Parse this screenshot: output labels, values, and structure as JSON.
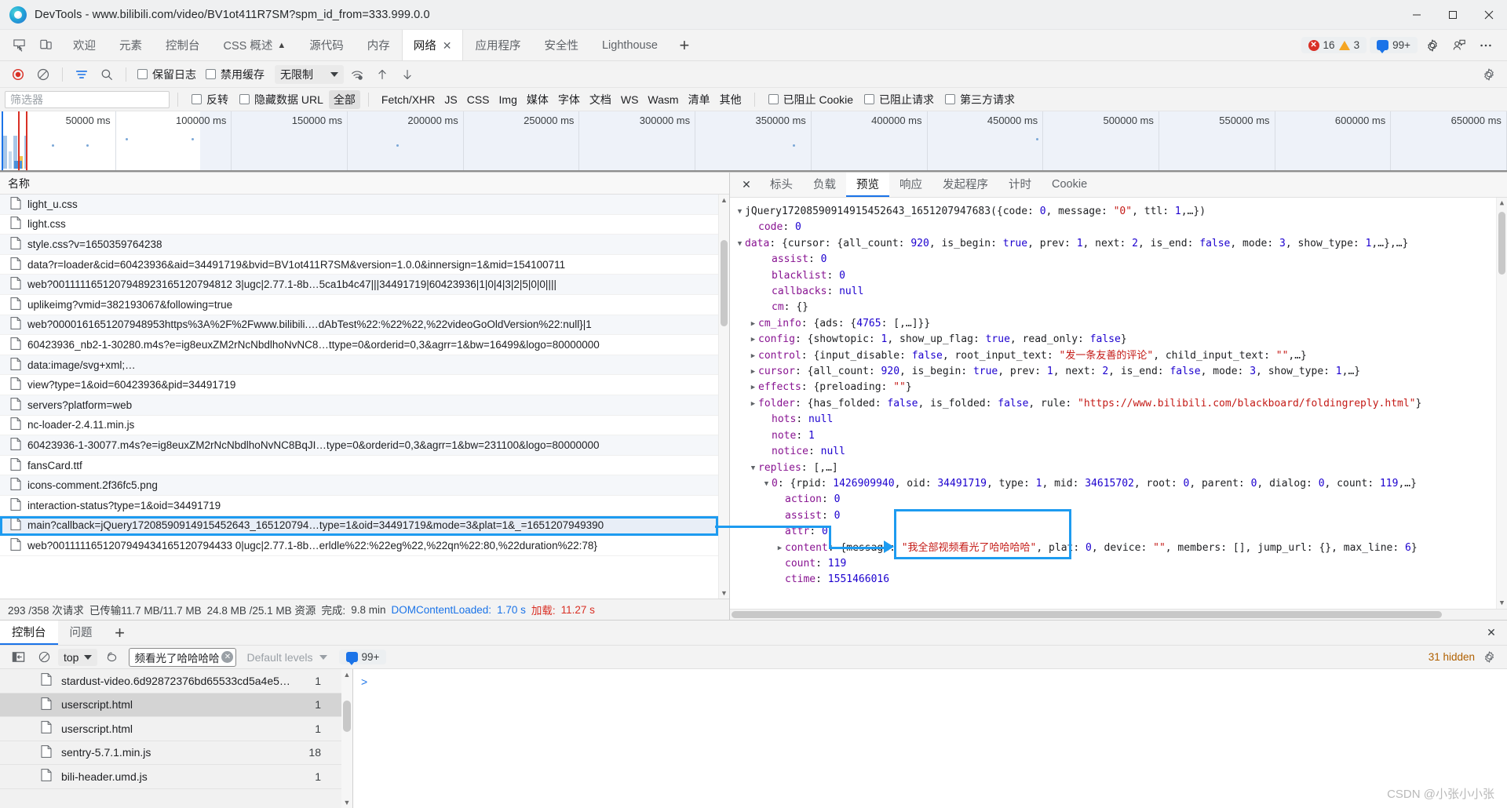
{
  "window": {
    "title": "DevTools - www.bilibili.com/video/BV1ot411R7SM?spm_id_from=333.999.0.0",
    "minimize_label": "—",
    "maximize_label": "□",
    "close_label": "✕"
  },
  "panel_tabs": {
    "items": [
      {
        "label": "欢迎",
        "active": false
      },
      {
        "label": "元素",
        "active": false
      },
      {
        "label": "控制台",
        "active": false
      },
      {
        "label": "CSS 概述",
        "active": false,
        "badge": "▲"
      },
      {
        "label": "源代码",
        "active": false
      },
      {
        "label": "内存",
        "active": false
      },
      {
        "label": "网络",
        "active": true,
        "closable": true
      },
      {
        "label": "应用程序",
        "active": false
      },
      {
        "label": "安全性",
        "active": false
      },
      {
        "label": "Lighthouse",
        "active": false
      }
    ],
    "add_label": "+",
    "errors": "16",
    "warnings": "3",
    "messages": "99+",
    "icons": [
      "inspect-icon",
      "device-toolbar-icon",
      "gear-icon",
      "profile-icon",
      "more-icon"
    ]
  },
  "network_toolbar": {
    "record_title": "record-button",
    "clear_title": "clear-button",
    "filter_title": "filter-button",
    "search_title": "search-button",
    "preserve_log": "保留日志",
    "disable_cache": "禁用缓存",
    "throttle_value": "无限制",
    "wifi_title": "network-conditions-icon",
    "import_title": "import-har-icon",
    "export_title": "export-har-icon",
    "settings_title": "settings-gear-icon"
  },
  "filter_bar": {
    "placeholder": "筛选器",
    "invert": "反转",
    "hide_data_urls": "隐藏数据 URL",
    "types": [
      "全部",
      "Fetch/XHR",
      "JS",
      "CSS",
      "Img",
      "媒体",
      "字体",
      "文档",
      "WS",
      "Wasm",
      "清单",
      "其他"
    ],
    "active_type": "全部",
    "blocked_cookies": "已阻止 Cookie",
    "blocked_requests": "已阻止请求",
    "third_party": "第三方请求"
  },
  "overview": {
    "ticks": [
      "50000 ms",
      "100000 ms",
      "150000 ms",
      "200000 ms",
      "250000 ms",
      "300000 ms",
      "350000 ms",
      "400000 ms",
      "450000 ms",
      "500000 ms",
      "550000 ms",
      "600000 ms",
      "650000 ms"
    ]
  },
  "request_table": {
    "column_name": "名称",
    "rows": [
      {
        "name": "light_u.css",
        "selected": false
      },
      {
        "name": "light.css",
        "selected": false
      },
      {
        "name": "style.css?v=1650359764238",
        "selected": false
      },
      {
        "name": "data?r=loader&cid=60423936&aid=34491719&bvid=BV1ot411R7SM&version=1.0.0&innersign=1&mid=154100711",
        "selected": false
      },
      {
        "name": "web?0011111651207948923165120794812 3|ugc|2.77.1-8b…5ca1b4c47|||34491719|60423936|1|0|4|3|2|5|0|0||||",
        "selected": false
      },
      {
        "name": "uplikeimg?vmid=382193067&following=true",
        "selected": false
      },
      {
        "name": "web?0000161651207948953https%3A%2F%2Fwww.bilibili.…dAbTest%22:%22%22,%22videoGoOldVersion%22:null}|1",
        "selected": false
      },
      {
        "name": "60423936_nb2-1-30280.m4s?e=ig8euxZM2rNcNbdlhoNvNC8…ttype=0&orderid=0,3&agrr=1&bw=16499&logo=80000000",
        "selected": false
      },
      {
        "name": "data:image/svg+xml;…",
        "selected": false
      },
      {
        "name": "view?type=1&oid=60423936&pid=34491719",
        "selected": false
      },
      {
        "name": "servers?platform=web",
        "selected": false
      },
      {
        "name": "nc-loader-2.4.11.min.js",
        "selected": false
      },
      {
        "name": "60423936-1-30077.m4s?e=ig8euxZM2rNcNbdlhoNvNC8BqJI…type=0&orderid=0,3&agrr=1&bw=231100&logo=80000000",
        "selected": false
      },
      {
        "name": "fansCard.ttf",
        "selected": false
      },
      {
        "name": "icons-comment.2f36fc5.png",
        "selected": false
      },
      {
        "name": "interaction-status?type=1&oid=34491719",
        "selected": false
      },
      {
        "name": "main?callback=jQuery17208590914915452643_165120794…type=1&oid=34491719&mode=3&plat=1&_=1651207949390",
        "selected": true
      },
      {
        "name": "web?0011111651207949434165120794433 0|ugc|2.77.1-8b…erldle%22:%22eg%22,%22qn%22:80,%22duration%22:78}",
        "selected": false
      }
    ]
  },
  "status_bar": {
    "requests": "293 /358 次请求",
    "transferred": "已传输11.7 MB/11.7 MB",
    "resources": "24.8 MB /25.1 MB 资源",
    "finish_label": "完成:",
    "finish_value": "9.8 min",
    "dcl_label": "DOMContentLoaded:",
    "dcl_value": "1.70 s",
    "load_label": "加载:",
    "load_value": "11.27 s"
  },
  "detail_pane": {
    "close_label": "✕",
    "tabs": [
      {
        "label": "标头",
        "active": false
      },
      {
        "label": "负载",
        "active": false
      },
      {
        "label": "预览",
        "active": true
      },
      {
        "label": "响应",
        "active": false
      },
      {
        "label": "发起程序",
        "active": false
      },
      {
        "label": "计时",
        "active": false
      },
      {
        "label": "Cookie",
        "active": false
      }
    ],
    "preview_lines": [
      {
        "indent": 0,
        "tri": "▼",
        "text": "jQuery17208590914915452643_1651207947683({code: 0, message: \"0\", ttl: 1,…})"
      },
      {
        "indent": 1,
        "tri": "",
        "text": "code: 0"
      },
      {
        "indent": 0,
        "tri": "▼",
        "text": "data: {cursor: {all_count: 920, is_begin: true, prev: 1, next: 2, is_end: false, mode: 3, show_type: 1,…},…}"
      },
      {
        "indent": 2,
        "tri": "",
        "text": "assist: 0"
      },
      {
        "indent": 2,
        "tri": "",
        "text": "blacklist: 0"
      },
      {
        "indent": 2,
        "tri": "",
        "text": "callbacks: null"
      },
      {
        "indent": 2,
        "tri": "",
        "text": "cm: {}"
      },
      {
        "indent": 1,
        "tri": "▶",
        "text": "cm_info: {ads: {4765: [,…]}}"
      },
      {
        "indent": 1,
        "tri": "▶",
        "text": "config: {showtopic: 1, show_up_flag: true, read_only: false}"
      },
      {
        "indent": 1,
        "tri": "▶",
        "text": "control: {input_disable: false, root_input_text: \"发一条友善的评论\", child_input_text: \"\",…}"
      },
      {
        "indent": 1,
        "tri": "▶",
        "text": "cursor: {all_count: 920, is_begin: true, prev: 1, next: 2, is_end: false, mode: 3, show_type: 1,…}"
      },
      {
        "indent": 1,
        "tri": "▶",
        "text": "effects: {preloading: \"\"}"
      },
      {
        "indent": 1,
        "tri": "▶",
        "text": "folder: {has_folded: false, is_folded: false, rule: \"https://www.bilibili.com/blackboard/foldingreply.html\"}"
      },
      {
        "indent": 2,
        "tri": "",
        "text": "hots: null"
      },
      {
        "indent": 2,
        "tri": "",
        "text": "note: 1"
      },
      {
        "indent": 2,
        "tri": "",
        "text": "notice: null"
      },
      {
        "indent": 1,
        "tri": "▼",
        "text": "replies: [,…]"
      },
      {
        "indent": 2,
        "tri": "▼",
        "text": "0: {rpid: 1426909940, oid: 34491719, type: 1, mid: 34615702, root: 0, parent: 0, dialog: 0, count: 119,…}"
      },
      {
        "indent": 3,
        "tri": "",
        "text": "action: 0"
      },
      {
        "indent": 3,
        "tri": "",
        "text": "assist: 0"
      },
      {
        "indent": 3,
        "tri": "",
        "text": "attr: 0"
      },
      {
        "indent": 3,
        "tri": "▶",
        "text": "content: {message: \"我全部视频看光了哈哈哈哈\", plat: 0, device: \"\", members: [], jump_url: {}, max_line: 6}"
      },
      {
        "indent": 3,
        "tri": "",
        "text": "count: 119"
      },
      {
        "indent": 3,
        "tri": "",
        "text": "ctime: 1551466016"
      }
    ]
  },
  "drawer": {
    "tabs": [
      {
        "label": "控制台",
        "active": true
      },
      {
        "label": "问题",
        "active": false
      }
    ],
    "add_label": "+",
    "close_label": "✕",
    "context_value": "top",
    "filter_value": "频看光了哈哈哈哈",
    "levels_value": "Default levels",
    "message_count": "99+",
    "hidden_note": "31 hidden",
    "prompt": ">",
    "autocomplete_rows": [
      {
        "name": "stardust-video.6d92872376bd65533cd5a4e5…",
        "count": "1",
        "selected": false
      },
      {
        "name": "userscript.html",
        "count": "1",
        "selected": true
      },
      {
        "name": "userscript.html",
        "count": "1",
        "selected": false
      },
      {
        "name": "sentry-5.7.1.min.js",
        "count": "18",
        "selected": false
      },
      {
        "name": "bili-header.umd.js",
        "count": "1",
        "selected": false
      }
    ]
  },
  "watermark": "CSDN @小张小小张",
  "colors": {
    "accent": "#1a73e8",
    "callout": "#1d9bf0",
    "error": "#d93025",
    "warning": "#f5a623",
    "load_red": "#d93025"
  }
}
